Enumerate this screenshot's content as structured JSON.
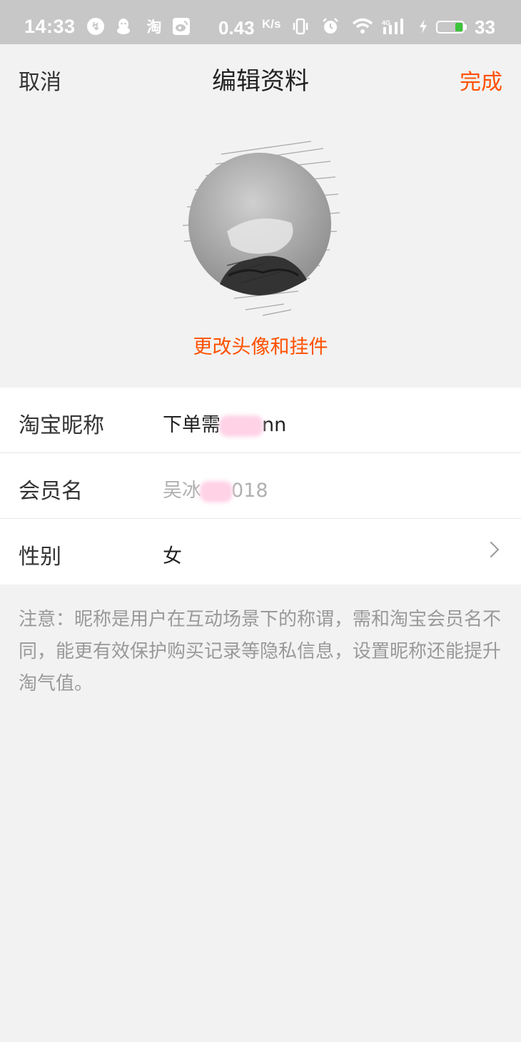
{
  "status_bar": {
    "time": "14:33",
    "tao_glyph": "淘",
    "net_speed": "0.43",
    "net_speed_unit": "K/s",
    "battery_level": "33",
    "battery_color": "#3cc43c",
    "icons": [
      "hotspot-icon",
      "qq-icon",
      "taobao-icon",
      "weibo-icon",
      "vibrate-icon",
      "alarm-icon",
      "wifi-icon",
      "signal-icon",
      "charging-icon",
      "battery-icon"
    ]
  },
  "nav": {
    "cancel_label": "取消",
    "title": "编辑资料",
    "done_label": "完成"
  },
  "profile": {
    "change_avatar_label": "更改头像和挂件"
  },
  "fields": {
    "nickname": {
      "label": "淘宝昵称",
      "value_prefix": "下单需",
      "value_suffix": "nn"
    },
    "member_name": {
      "label": "会员名",
      "value_prefix": "吴冰",
      "value_suffix": "018"
    },
    "gender": {
      "label": "性别",
      "value": "女"
    }
  },
  "note": "注意：昵称是用户在互动场景下的称谓，需和淘宝会员名不同，能更有效保护购买记录等隐私信息，设置昵称还能提升淘气值。",
  "colors": {
    "accent": "#ff5000",
    "status_bar_bg": "#c7c7c7",
    "page_bg": "#f2f2f2"
  }
}
